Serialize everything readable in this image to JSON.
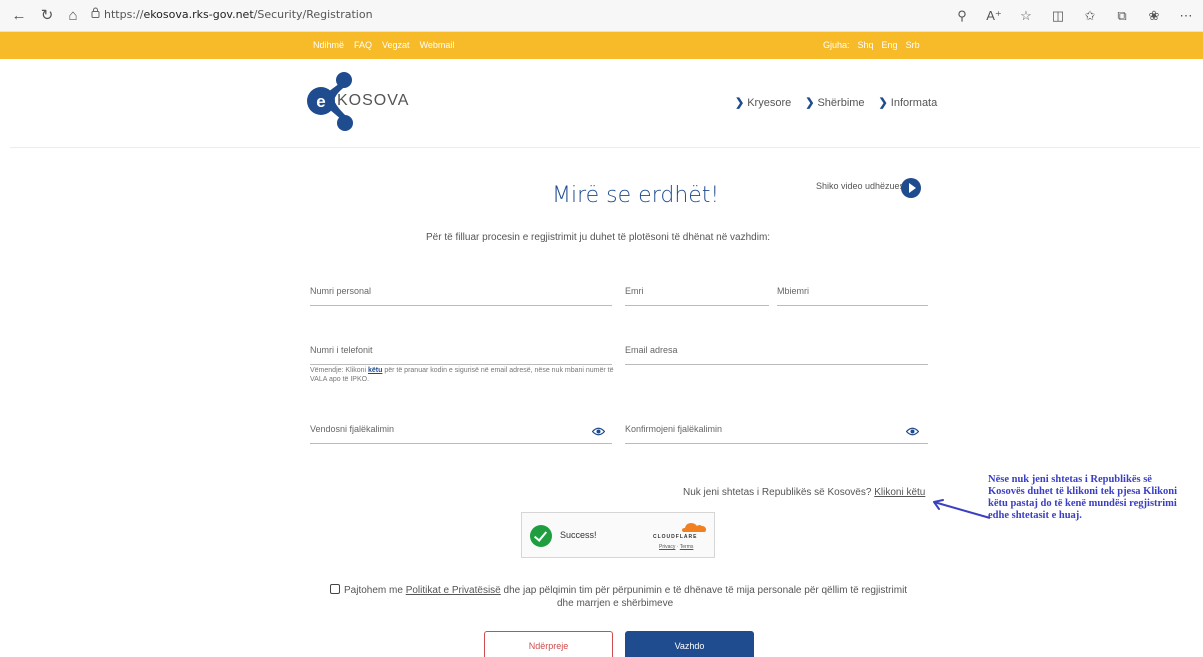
{
  "browser": {
    "url_prefix": "https://",
    "url_host": "ekosova.rks-gov.net",
    "url_path": "/Security/Registration",
    "icons": [
      "back-icon",
      "refresh-icon",
      "home-icon",
      "lock-icon",
      "search-icon",
      "read-aloud-icon",
      "favorite-icon",
      "split-screen-icon",
      "favorites-bar-icon",
      "collections-icon",
      "extension-icon",
      "more-icon"
    ]
  },
  "topbar": {
    "links": [
      "Ndihmë",
      "FAQ",
      "Vegzat",
      "Webmail"
    ],
    "lang_label": "Gjuha:",
    "langs": [
      "Shq",
      "Eng",
      "Srb"
    ],
    "color": "#f7bb2a"
  },
  "header": {
    "logo_text": "KOSOVA",
    "nav": [
      "Kryesore",
      "Shërbime",
      "Informata"
    ]
  },
  "page": {
    "title": "Mirë se erdhët!",
    "video_link": "Shiko video udhëzuesin",
    "intro": "Për të filluar procesin e regjistrimit ju duhet të plotësoni të dhënat në vazhdim:"
  },
  "form": {
    "personal_number": "Numri personal",
    "first_name": "Emri",
    "last_name": "Mbiemri",
    "phone": "Numri i telefonit",
    "email": "Email adresa",
    "hint_before": "Vëmendje: Klikoni ",
    "hint_link": "këtu",
    "hint_after": " për të pranuar kodin e sigurisë në email adresë, nëse nuk mbani numër të VALA apo të IPKO.",
    "password": "Vendosni fjalëkalimin",
    "confirm_password": "Konfirmojeni fjalëkalimin",
    "not_citizen_text": "Nuk jeni shtetas i Republikës së Kosovës?",
    "not_citizen_link": "Klikoni këtu"
  },
  "captcha": {
    "status": "Success!",
    "brand": "CLOUDFLARE",
    "privacy": "Privacy",
    "sep": "·",
    "terms": "Terms"
  },
  "consent": {
    "before": "Pajtohem me ",
    "link": "Politikat e Privatësisë",
    "after": " dhe jap pëlqimin tim për përpunimin e të dhënave të mija personale për qëllim të regjistrimit",
    "line2": "dhe marrjen e shërbimeve"
  },
  "buttons": {
    "cancel": "Ndërpreje",
    "continue": "Vazhdo"
  },
  "annotation": {
    "text": "Nëse nuk jeni shtetas i Republikës së Kosovës duhet të klikoni tek pjesa Klikoni këtu pastaj do të kenë mundësi regjistrimi edhe shtetasit e huaj."
  },
  "colors": {
    "brand_blue": "#1f4b8f",
    "cancel_red": "#d14c4c",
    "success_green": "#1e9e3f",
    "annotation_blue": "#3b3fc2"
  }
}
